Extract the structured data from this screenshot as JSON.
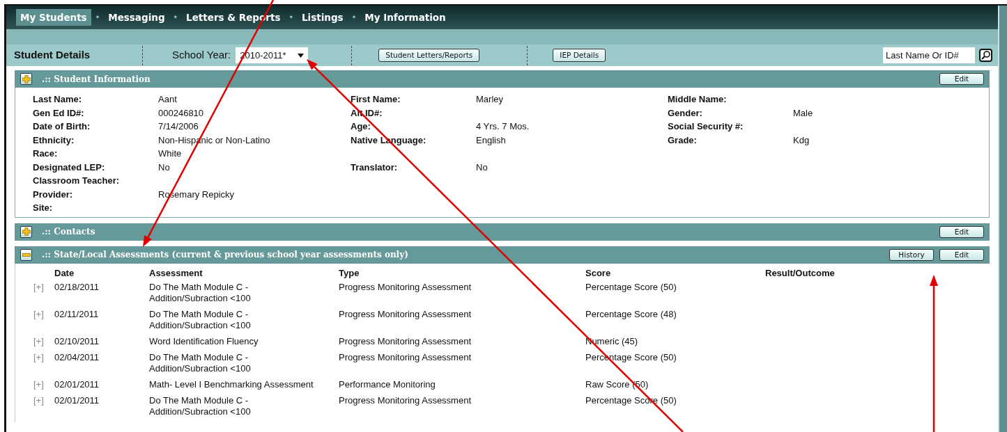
{
  "nav": {
    "tabs": [
      {
        "label": "My Students",
        "selected": true
      },
      {
        "label": "Messaging",
        "selected": false
      },
      {
        "label": "Letters & Reports",
        "selected": false
      },
      {
        "label": "Listings",
        "selected": false
      },
      {
        "label": "My Information",
        "selected": false
      }
    ],
    "separator": "•"
  },
  "toolbar": {
    "title": "Student Details",
    "school_year_label": "School Year:",
    "school_year_value": "2010-2011*",
    "buttons": [
      "Student Letters/Reports",
      "IEP Details"
    ],
    "search": {
      "placeholder": "Last Name Or ID#"
    }
  },
  "sections": [
    {
      "title": ".:: Student Information",
      "expanded": false,
      "buttons": [
        "Edit"
      ],
      "fields": [
        {
          "left": {
            "label": "Last Name:",
            "value": "Aant"
          },
          "middle": {
            "label": "First Name:",
            "value": "Marley"
          },
          "right": {
            "label": "Middle Name:"
          }
        },
        {
          "left": {
            "label": "Gen Ed ID#:",
            "value": "000246810"
          },
          "middle": {
            "label": "Alt ID#:"
          },
          "right": {
            "label": "Gender:",
            "value": "Male"
          }
        },
        {
          "left": {
            "label": "Date of Birth:",
            "value": "7/14/2006"
          },
          "middle": {
            "label": "Age:",
            "value": "4 Yrs. 7 Mos."
          },
          "right": {
            "label": "Social Security #:"
          }
        },
        {
          "left": {
            "label": "Ethnicity:",
            "value": "Non-Hispanic or Non-Latino"
          },
          "middle": {
            "label": "Native Language:",
            "value": "English"
          },
          "right": {
            "label": "Grade:",
            "value": "Kdg"
          }
        },
        {
          "left": {
            "label": "Race:",
            "value": "White"
          }
        },
        {
          "left": {
            "label": "Designated LEP:",
            "value": "No"
          },
          "middle": {
            "label": "Translator:",
            "value": "No"
          }
        },
        {
          "left": {
            "label": "Classroom Teacher:"
          }
        },
        {
          "left": {
            "label": "Provider:",
            "value": "Rosemary Repicky"
          }
        },
        {
          "left": {
            "label": "Site:"
          }
        }
      ]
    },
    {
      "title": ".:: Contacts",
      "expanded": false,
      "buttons": [
        "Edit"
      ]
    },
    {
      "title": ".:: State/Local Assessments (current & previous school year assessments only)",
      "expanded": true,
      "buttons": [
        "History",
        "Edit"
      ],
      "table": {
        "columns": [
          "Date",
          "Assessment",
          "Type",
          "Score",
          "Result/Outcome"
        ],
        "rows": [
          {
            "expander": "[+]",
            "date": "02/18/2011",
            "assessment": "Do The Math Module C - Addition/Subraction <100",
            "type": "Progress Monitoring Assessment",
            "score": "Percentage Score (50)"
          },
          {
            "expander": "[+]",
            "date": "02/11/2011",
            "assessment": "Do The Math Module C - Addition/Subraction <100",
            "type": "Progress Monitoring Assessment",
            "score": "Percentage Score (48)"
          },
          {
            "expander": "[+]",
            "date": "02/10/2011",
            "assessment": "Word Identification Fluency",
            "type": "Progress Monitoring Assessment",
            "score": "Numeric (45)"
          },
          {
            "expander": "[+]",
            "date": "02/04/2011",
            "assessment": "Do The Math Module C - Addition/Subraction <100",
            "type": "Progress Monitoring Assessment",
            "score": "Percentage Score (50)"
          },
          {
            "expander": "[+]",
            "date": "02/01/2011",
            "assessment": "Math- Level I Benchmarking Assessment",
            "type": "Performance Monitoring",
            "score": "Raw Score (50)"
          },
          {
            "expander": "[+]",
            "date": "02/01/2011",
            "assessment": "Do The Math Module C - Addition/Subraction <100",
            "type": "Progress Monitoring Assessment",
            "score": "Percentage Score (50)"
          }
        ]
      }
    }
  ],
  "annotations": [
    {
      "kind": "arrow"
    },
    {
      "kind": "arrow"
    },
    {
      "kind": "arrow"
    }
  ]
}
